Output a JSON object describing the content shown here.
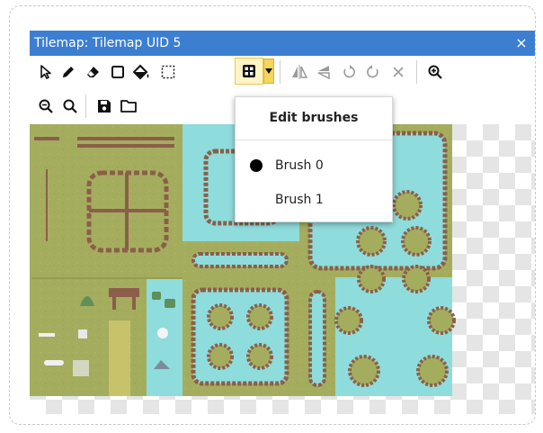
{
  "window": {
    "title": "Tilemap: Tilemap UID 5",
    "close_glyph": "×"
  },
  "toolbar": {
    "row1": [
      "cursor-icon",
      "pencil-icon",
      "eraser-icon",
      "rectangle-icon",
      "bucket-fill-icon",
      "rect-select-icon",
      "brush-icon",
      "brush-dropdown-icon",
      "flip-horizontal-icon",
      "flip-vertical-icon",
      "rotate-left-icon",
      "rotate-right-icon",
      "clear-icon",
      "zoom-in-icon"
    ],
    "row2": [
      "zoom-out-icon",
      "zoom-reset-icon",
      "save-icon",
      "folder-icon"
    ],
    "accent": "#3c7fd1",
    "active_tool": "brush-icon"
  },
  "brush_menu": {
    "header": "Edit brushes",
    "items": [
      {
        "label": "Brush 0",
        "selected": true
      },
      {
        "label": "Brush 1",
        "selected": false
      }
    ]
  },
  "colors": {
    "grass": "#a4ad5e",
    "water": "#8fdcdc",
    "fence": "#8b5e4a",
    "checker": "#e5e5e5"
  }
}
